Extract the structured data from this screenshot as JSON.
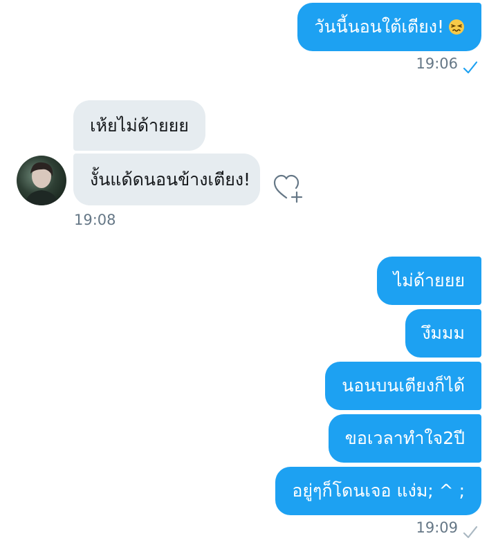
{
  "messages": {
    "m1": "วันนี้นอนใต้เตียง!",
    "m1_emoji": "confounded-face-emoji",
    "m2": "เห้ยไม่ด้ายยย",
    "m3": "งั้นแด้ดนอนข้างเตียง!",
    "m4": "ไม่ด้ายยย",
    "m5": "งึมมม",
    "m6": "นอนบนเตียงก็ได้",
    "m7": "ขอเวลาทำใจ2ปี",
    "m8": "อยู่ๆก็โดนเจอ แง่ม; ^ ;"
  },
  "times": {
    "t1": "19:06",
    "t2": "19:08",
    "t3": "19:09"
  },
  "colors": {
    "outgoing_bubble": "#1da1f2",
    "incoming_bubble": "#e6ecf0",
    "read_check": "#1da1f2",
    "sent_check": "#aab8c2"
  },
  "icons": {
    "read_receipt": "check-icon",
    "reaction": "heart-plus-icon",
    "avatar": "avatar"
  }
}
